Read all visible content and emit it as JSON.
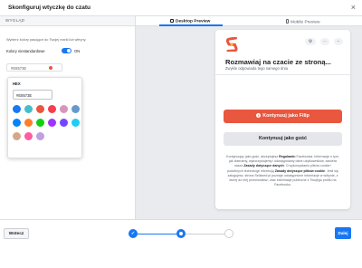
{
  "modal": {
    "title": "Skonfiguruj wtyczkę do czatu",
    "close_glyph": "×"
  },
  "left": {
    "section_title": "WYGLĄD",
    "help_text": "Wybierz kolory pasujące do Twojej marki lub witryny.",
    "custom_colors_label": "Kolory niestandardowe",
    "toggle_state": "ON",
    "color_value": "#E8573E",
    "picker": {
      "label": "HEX",
      "hex_value": "#E8573E",
      "swatches": [
        "#1877f2",
        "#44bec7",
        "#e8573e",
        "#fa3c4c",
        "#d696bb",
        "#6699cc",
        "#0084ff",
        "#ff7e29",
        "#13cf13",
        "#a033ff",
        "#7646ff",
        "#20cef5",
        "#d4a88c",
        "#ff5ca1",
        "#c0a0e0"
      ]
    }
  },
  "right": {
    "tabs": {
      "desktop": "Desktop Preview",
      "mobile": "Mobile Preview"
    },
    "chat": {
      "title": "Rozmawiaj na czacie ze stroną...",
      "subtitle": "Zwykle odpowiada tego samego dnia",
      "primary_button": "Kontynuuj jako Filip",
      "secondary_button": "Kontynuuj jako gość",
      "legal": {
        "p1": "Kontynuując jako gość, akceptujesz ",
        "b1": "Regulamin",
        "p2": " Facebooka. Informacje o tym, jak zbieramy, wykorzystujemy i udostępniamy dane użytkowników, zawiera nasza ",
        "b2": "Zasady dotyczące danych",
        "p3": ". O wykorzystaniu plików cookie i podobnych technologii informują ",
        "b3": "Zasady dotyczące plików cookie",
        "p4": ". Jeśli się zalogujesz, strona Sellaxed pl poznaje udostępnione informacje w witrynie, z której do niej przechodzisz, oraz informacje publiczne z Twojego profilu na Facebooku."
      }
    }
  },
  "footer": {
    "back_label": "Wstecz",
    "next_label": "Dalej",
    "step1_mark": "✓"
  },
  "colors": {
    "accent": "#1877f2",
    "brand": "#e8573e"
  }
}
